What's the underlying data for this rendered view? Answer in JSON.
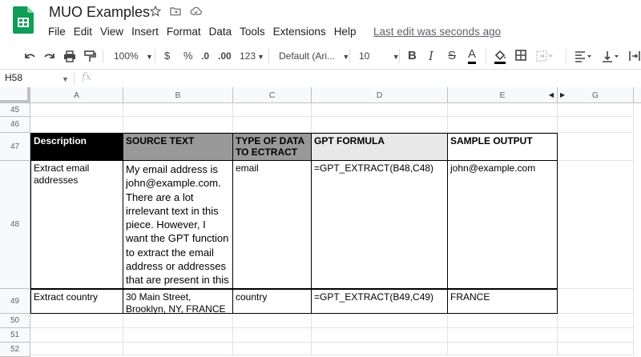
{
  "header": {
    "title": "MUO Examples",
    "last_edit": "Last edit was seconds ago",
    "menu": [
      "File",
      "Edit",
      "View",
      "Insert",
      "Format",
      "Data",
      "Tools",
      "Extensions",
      "Help"
    ]
  },
  "toolbar": {
    "zoom": "100%",
    "currency": "$",
    "percent": "%",
    "decrease_decimal": ".0",
    "increase_decimal": ".00",
    "more_formats": "123",
    "font": "Default (Ari...",
    "font_size": "10",
    "bold": "B",
    "italic": "I",
    "strikethrough": "S",
    "text_color": "A"
  },
  "formula_bar": {
    "name_box": "H58",
    "fx": "fx"
  },
  "grid": {
    "columns": [
      "A",
      "B",
      "C",
      "D",
      "E",
      "G"
    ],
    "rows": [
      "45",
      "46",
      "47",
      "48",
      "49",
      "50",
      "51",
      "52"
    ],
    "table": {
      "headers": [
        "Description",
        "SOURCE TEXT",
        "TYPE OF DATA TO ECTRACT",
        "GPT FORMULA",
        "SAMPLE OUTPUT"
      ],
      "row48": {
        "description": "Extract email addresses",
        "source": "My email address is john@example.com. There are a lot irrelevant text in this piece. However, I want the GPT function to extract the email address or addresses that are present in this cell",
        "type": "email",
        "formula": "=GPT_EXTRACT(B48,C48)",
        "output": "john@example.com"
      },
      "row49": {
        "description": "Extract country",
        "source": "30 Main Street, Brooklyn, NY, FRANCE",
        "type": "country",
        "formula": "=GPT_EXTRACT(B49,C49)",
        "output": "FRANCE"
      }
    }
  },
  "colors": {
    "header_dark": "#000000",
    "header_gray": "#999999",
    "header_light": "#e8e8e8",
    "sheets_green": "#0f9d58"
  }
}
